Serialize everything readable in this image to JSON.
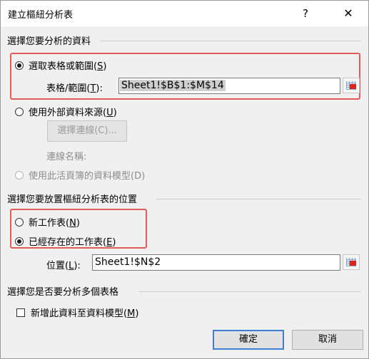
{
  "window": {
    "title": "建立樞紐分析表",
    "help_glyph": "?",
    "close_glyph": "✕"
  },
  "source_section": {
    "heading": "選擇您要分析的資料",
    "option_range": {
      "text": "選取表格或範圍",
      "key": "S",
      "checked": true
    },
    "range_field": {
      "label": "表格/範圍",
      "key": "T",
      "value": "Sheet1!$B$1:$M$14"
    },
    "option_external": {
      "text": "使用外部資料來源",
      "key": "U",
      "checked": false
    },
    "choose_connection_button": {
      "text": "選擇連線(C)..."
    },
    "connection_name_label": "連線名稱:",
    "option_model": {
      "text": "使用此活頁簿的資料模型(D)",
      "checked": false,
      "disabled": true
    }
  },
  "placement_section": {
    "heading": "選擇您要放置樞紐分析表的位置",
    "option_new": {
      "text": "新工作表",
      "key": "N",
      "checked": false
    },
    "option_existing": {
      "text": "已經存在的工作表",
      "key": "E",
      "checked": true
    },
    "location_field": {
      "label": "位置",
      "key": "L",
      "value": "Sheet1!$N$2"
    }
  },
  "multiple_section": {
    "heading": "選擇您是否要分析多個表格",
    "add_to_model": {
      "text": "新增此資料至資料模型",
      "key": "M",
      "checked": false
    }
  },
  "footer": {
    "ok": "確定",
    "cancel": "取消"
  },
  "colors": {
    "highlight_border": "#e25b5b",
    "default_button_border": "#3c7fd3",
    "dialog_bg": "#f0f0f0"
  }
}
